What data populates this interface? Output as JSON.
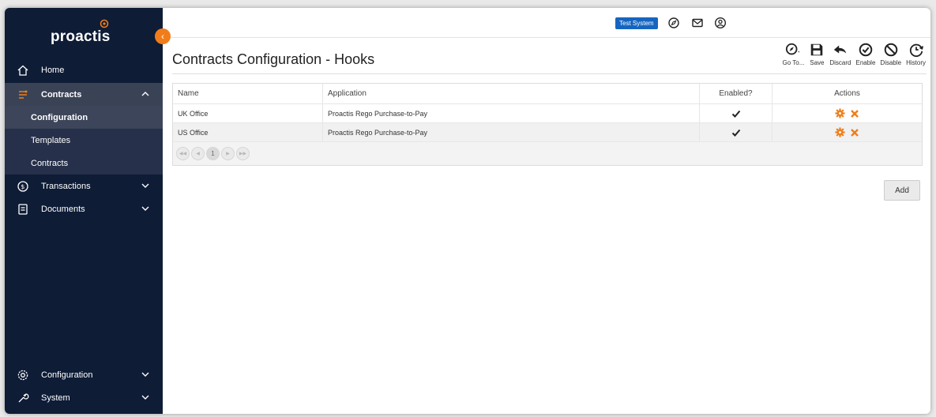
{
  "app": {
    "logo_text": "proactis",
    "badge": "Test System"
  },
  "page": {
    "title": "Contracts Configuration - Hooks"
  },
  "toolbar": [
    {
      "name": "go-to",
      "label": "Go To..."
    },
    {
      "name": "save",
      "label": "Save"
    },
    {
      "name": "discard",
      "label": "Discard"
    },
    {
      "name": "enable",
      "label": "Enable"
    },
    {
      "name": "disable",
      "label": "Disable"
    },
    {
      "name": "history",
      "label": "History"
    }
  ],
  "sidebar": {
    "home": "Home",
    "contracts": "Contracts",
    "sub": [
      "Configuration",
      "Templates",
      "Contracts"
    ],
    "transactions": "Transactions",
    "documents": "Documents",
    "configuration": "Configuration",
    "system": "System"
  },
  "grid": {
    "headers": [
      "Name",
      "Application",
      "Enabled?",
      "Actions"
    ],
    "rows": [
      {
        "name": "UK Office",
        "application": "Proactis Rego Purchase-to-Pay"
      },
      {
        "name": "US Office",
        "application": "Proactis Rego Purchase-to-Pay"
      }
    ],
    "pager": {
      "current": "1"
    }
  },
  "add_label": "Add",
  "colors": {
    "sidebar": "#0e1c36",
    "accent": "#f07d1a",
    "badge": "#1565c0"
  }
}
